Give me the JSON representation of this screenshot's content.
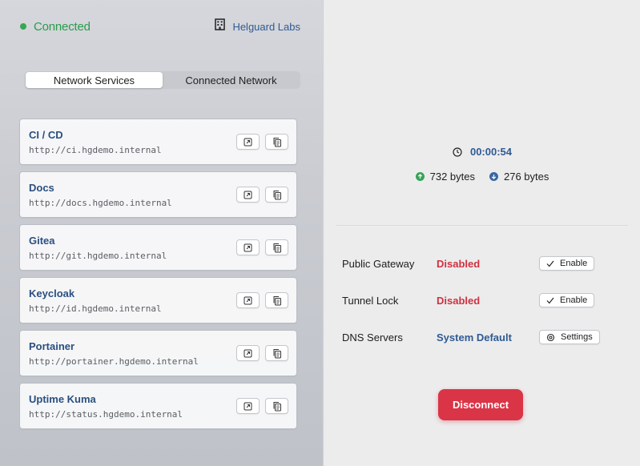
{
  "header": {
    "status": "Connected",
    "organization": "Helguard Labs",
    "status_color": "#34a853"
  },
  "tabs": [
    {
      "label": "Network Services",
      "active": true
    },
    {
      "label": "Connected Network",
      "active": false
    }
  ],
  "services": [
    {
      "name": "CI / CD",
      "url": "http://ci.hgdemo.internal"
    },
    {
      "name": "Docs",
      "url": "http://docs.hgdemo.internal"
    },
    {
      "name": "Gitea",
      "url": "http://git.hgdemo.internal"
    },
    {
      "name": "Keycloak",
      "url": "http://id.hgdemo.internal"
    },
    {
      "name": "Portainer",
      "url": "http://portainer.hgdemo.internal"
    },
    {
      "name": "Uptime Kuma",
      "url": "http://status.hgdemo.internal"
    }
  ],
  "session": {
    "duration": "00:00:54",
    "uploaded": "732 bytes",
    "downloaded": "276 bytes"
  },
  "settings": [
    {
      "label": "Public Gateway",
      "value": "Disabled",
      "button": "Enable",
      "button_icon": "checkmark-icon"
    },
    {
      "label": "Tunnel Lock",
      "value": "Disabled",
      "button": "Enable",
      "button_icon": "checkmark-icon"
    },
    {
      "label": "DNS Servers",
      "value": "System Default",
      "button": "Settings",
      "button_icon": "gear-icon"
    }
  ],
  "actions": {
    "disconnect": "Disconnect"
  },
  "colors": {
    "accent_blue": "#2f5a92",
    "danger_red": "#d0313f",
    "success_green": "#2a9c4a",
    "disconnect_bg": "#da3447"
  }
}
